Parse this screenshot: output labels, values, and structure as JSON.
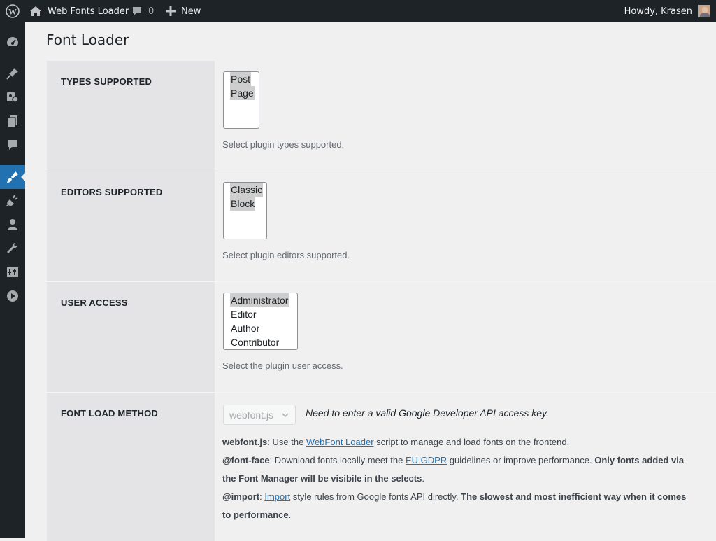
{
  "adminbar": {
    "site_name": "Web Fonts Loader",
    "comment_count": "0",
    "new_label": "New",
    "howdy": "Howdy, Krasen",
    "icons": [
      "wordpress-logo-icon",
      "home-icon",
      "comment-icon",
      "plus-icon"
    ]
  },
  "sidebar": {
    "icons": [
      "dashboard-icon",
      "pin-icon",
      "media-icon",
      "pages-icon",
      "comments-icon",
      "appearance-icon",
      "plugins-icon",
      "users-icon",
      "tools-icon",
      "settings-icon",
      "play-icon"
    ],
    "active": "appearance-icon",
    "accent": "#2271b1"
  },
  "page": {
    "title": "Font Loader"
  },
  "types": {
    "label": "TYPES SUPPORTED",
    "options": [
      "Post",
      "Page"
    ],
    "selected": [
      "Post",
      "Page"
    ],
    "description": "Select plugin types supported."
  },
  "editors": {
    "label": "EDITORS SUPPORTED",
    "options": [
      "Classic",
      "Block"
    ],
    "selected": [
      "Classic",
      "Block"
    ],
    "description": "Select plugin editors supported."
  },
  "access": {
    "label": "USER ACCESS",
    "options": [
      "Administrator",
      "Editor",
      "Author",
      "Contributor"
    ],
    "selected": [
      "Administrator"
    ],
    "description": "Select the plugin user access."
  },
  "method": {
    "label": "FONT LOAD METHOD",
    "select_value": "webfont.js",
    "warning": "Need to enter a valid Google Developer API access key.",
    "webfont_title": "webfont.js",
    "webfont_pre": ": Use the ",
    "webfont_link": "WebFont Loader",
    "webfont_post": " script to manage and load fonts on the frontend.",
    "fontface_title": "@font-face",
    "fontface_pre": ": Download fonts locally meet the ",
    "fontface_link": "EU GDPR",
    "fontface_mid": " guidelines or improve performance. ",
    "fontface_bold": "Only fonts added via the Font Manager will be visibile in the selects",
    "fontface_end": ".",
    "import_title": "@import",
    "import_pre": ": ",
    "import_link": "Import",
    "import_mid": " style rules from Google fonts API directly. ",
    "import_bold": "The slowest and most inefficient way when it comes to performance",
    "import_end": "."
  }
}
